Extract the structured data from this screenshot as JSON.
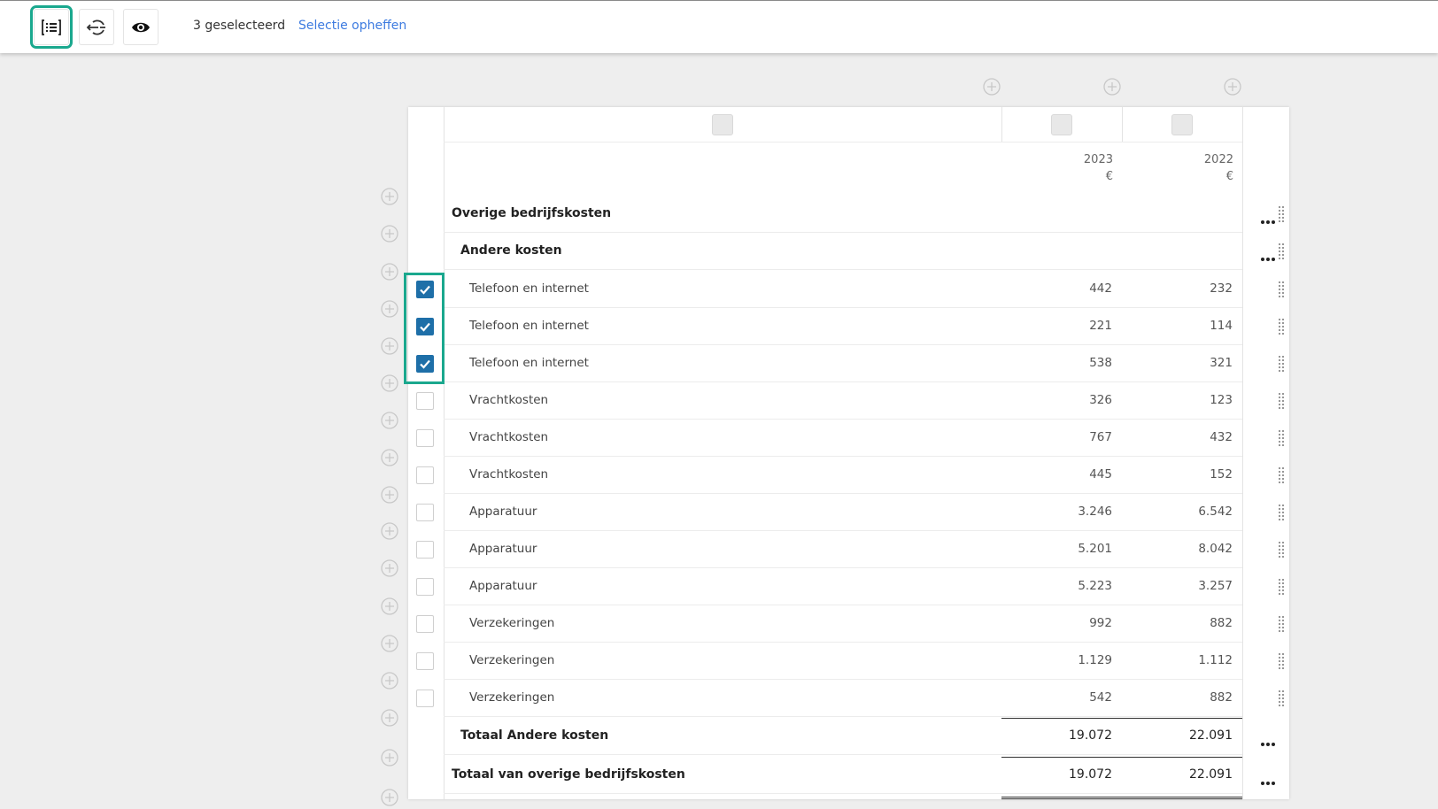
{
  "toolbar": {
    "selected_count": "3 geselecteerd",
    "clear_selection": "Selectie opheffen",
    "buttons": [
      {
        "icon": "list-select-icon",
        "active": true
      },
      {
        "icon": "toggle-mode-icon",
        "active": false
      },
      {
        "icon": "eye-icon",
        "active": false
      }
    ]
  },
  "table": {
    "columns": [
      {
        "year": "2023",
        "currency": "€"
      },
      {
        "year": "2022",
        "currency": "€"
      }
    ],
    "rows": [
      {
        "type": "heading",
        "level": 0,
        "label": "Overige bedrijfskosten"
      },
      {
        "type": "heading",
        "level": 1,
        "label": "Andere kosten"
      },
      {
        "type": "item",
        "label": "Telefoon en internet",
        "v2023": "442",
        "v2022": "232",
        "checked": true
      },
      {
        "type": "item",
        "label": "Telefoon en internet",
        "v2023": "221",
        "v2022": "114",
        "checked": true
      },
      {
        "type": "item",
        "label": "Telefoon en internet",
        "v2023": "538",
        "v2022": "321",
        "checked": true
      },
      {
        "type": "item",
        "label": "Vrachtkosten",
        "v2023": "326",
        "v2022": "123",
        "checked": false
      },
      {
        "type": "item",
        "label": "Vrachtkosten",
        "v2023": "767",
        "v2022": "432",
        "checked": false
      },
      {
        "type": "item",
        "label": "Vrachtkosten",
        "v2023": "445",
        "v2022": "152",
        "checked": false
      },
      {
        "type": "item",
        "label": "Apparatuur",
        "v2023": "3.246",
        "v2022": "6.542",
        "checked": false
      },
      {
        "type": "item",
        "label": "Apparatuur",
        "v2023": "5.201",
        "v2022": "8.042",
        "checked": false
      },
      {
        "type": "item",
        "label": "Apparatuur",
        "v2023": "5.223",
        "v2022": "3.257",
        "checked": false
      },
      {
        "type": "item",
        "label": "Verzekeringen",
        "v2023": "992",
        "v2022": "882",
        "checked": false
      },
      {
        "type": "item",
        "label": "Verzekeringen",
        "v2023": "1.129",
        "v2022": "1.112",
        "checked": false
      },
      {
        "type": "item",
        "label": "Verzekeringen",
        "v2023": "542",
        "v2022": "882",
        "checked": false
      },
      {
        "type": "total",
        "level": 1,
        "label": "Totaal Andere kosten",
        "v2023": "19.072",
        "v2022": "22.091"
      },
      {
        "type": "total",
        "level": 0,
        "label": "Totaal van overige bedrijfskosten",
        "v2023": "19.072",
        "v2022": "22.091"
      }
    ]
  },
  "colors": {
    "accent": "#1aa88e",
    "checkbox": "#1e6fa8",
    "link": "#3d7be0"
  }
}
